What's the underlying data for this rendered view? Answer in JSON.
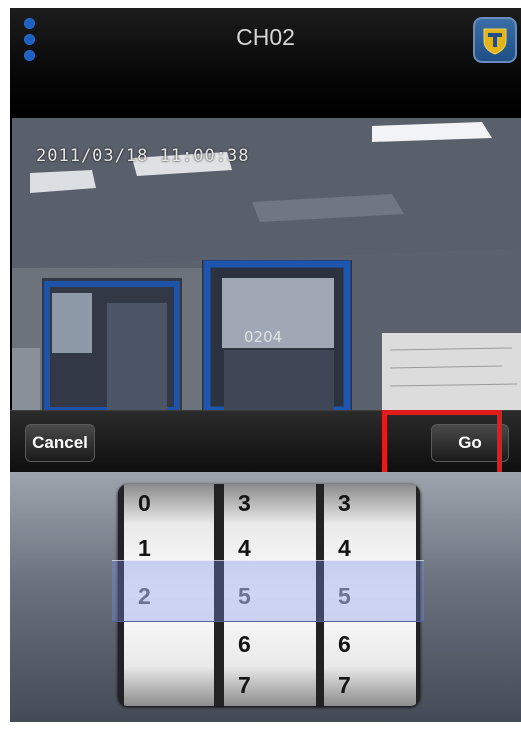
{
  "header": {
    "title": "CH02",
    "menu_icon": "menu-dots-icon",
    "brand_icon": "brand-shield-icon"
  },
  "video": {
    "timestamp": "2011/03/18 11:00:38",
    "room_sign": "0204"
  },
  "toolbar": {
    "cancel_label": "Cancel",
    "go_label": "Go"
  },
  "picker": {
    "wheels": [
      {
        "digits": [
          "0",
          "1",
          "2"
        ],
        "selected": "2"
      },
      {
        "digits": [
          "3",
          "4",
          "5",
          "6",
          "7"
        ],
        "selected": "5"
      },
      {
        "digits": [
          "3",
          "4",
          "5",
          "6",
          "7"
        ],
        "selected": "5"
      }
    ]
  },
  "colors": {
    "header_dots": "#1f5fbf",
    "highlight": "#e21b1b",
    "selection_band": "#7a8ce6"
  }
}
